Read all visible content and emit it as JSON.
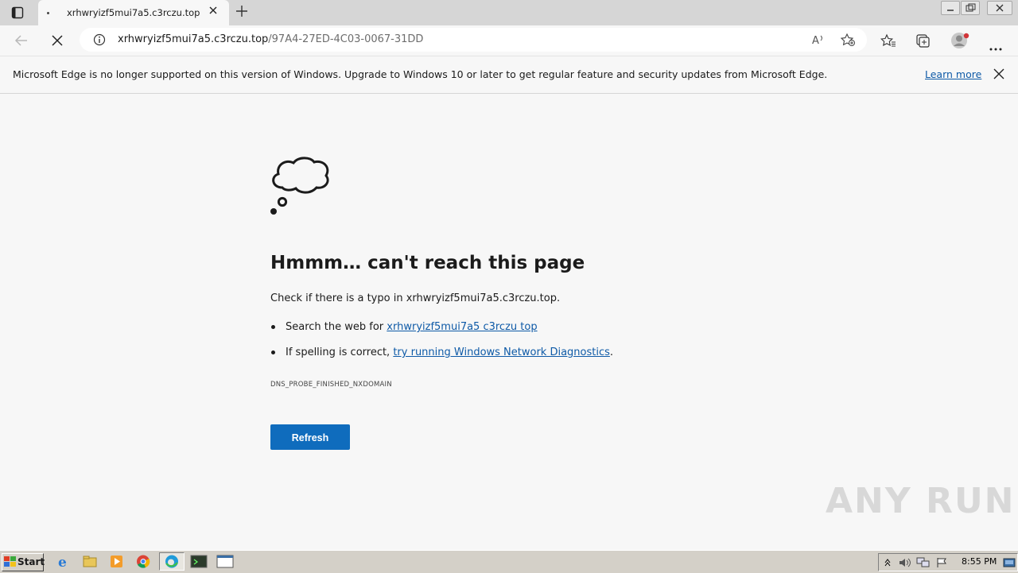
{
  "browser": {
    "tab": {
      "title": "xrhwryizf5mui7a5.c3rczu.top"
    },
    "address": {
      "host": "xrhwryizf5mui7a5.c3rczu.top",
      "path": "/97A4-27ED-4C03-0067-31DD"
    }
  },
  "infobar": {
    "message": "Microsoft Edge is no longer supported on this version of Windows. Upgrade to Windows 10 or later to get regular feature and security updates from Microsoft Edge.",
    "learn_more": "Learn more"
  },
  "error_page": {
    "heading": "Hmmm… can't reach this page",
    "check_text": "Check if there is a typo in xrhwryizf5mui7a5.c3rczu.top.",
    "bullets": [
      {
        "prefix": "Search the web for ",
        "link": "xrhwryizf5mui7a5 c3rczu top",
        "suffix": ""
      },
      {
        "prefix": "If spelling is correct, ",
        "link": "try running Windows Network Diagnostics",
        "suffix": "."
      }
    ],
    "error_code": "DNS_PROBE_FINISHED_NXDOMAIN",
    "refresh_label": "Refresh"
  },
  "watermark": "ANY RUN",
  "taskbar": {
    "start_label": "Start",
    "clock": "8:55 PM",
    "pinned_icons": [
      "ie-icon",
      "explorer-icon",
      "media-player-icon",
      "chrome-icon",
      "edge-icon",
      "terminal-icon",
      "window-icon"
    ]
  },
  "colors": {
    "accent": "#0f6cbd",
    "link": "#0e5aa7",
    "page_bg": "#f7f7f7",
    "tabbar_bg": "#d6d6d6"
  }
}
